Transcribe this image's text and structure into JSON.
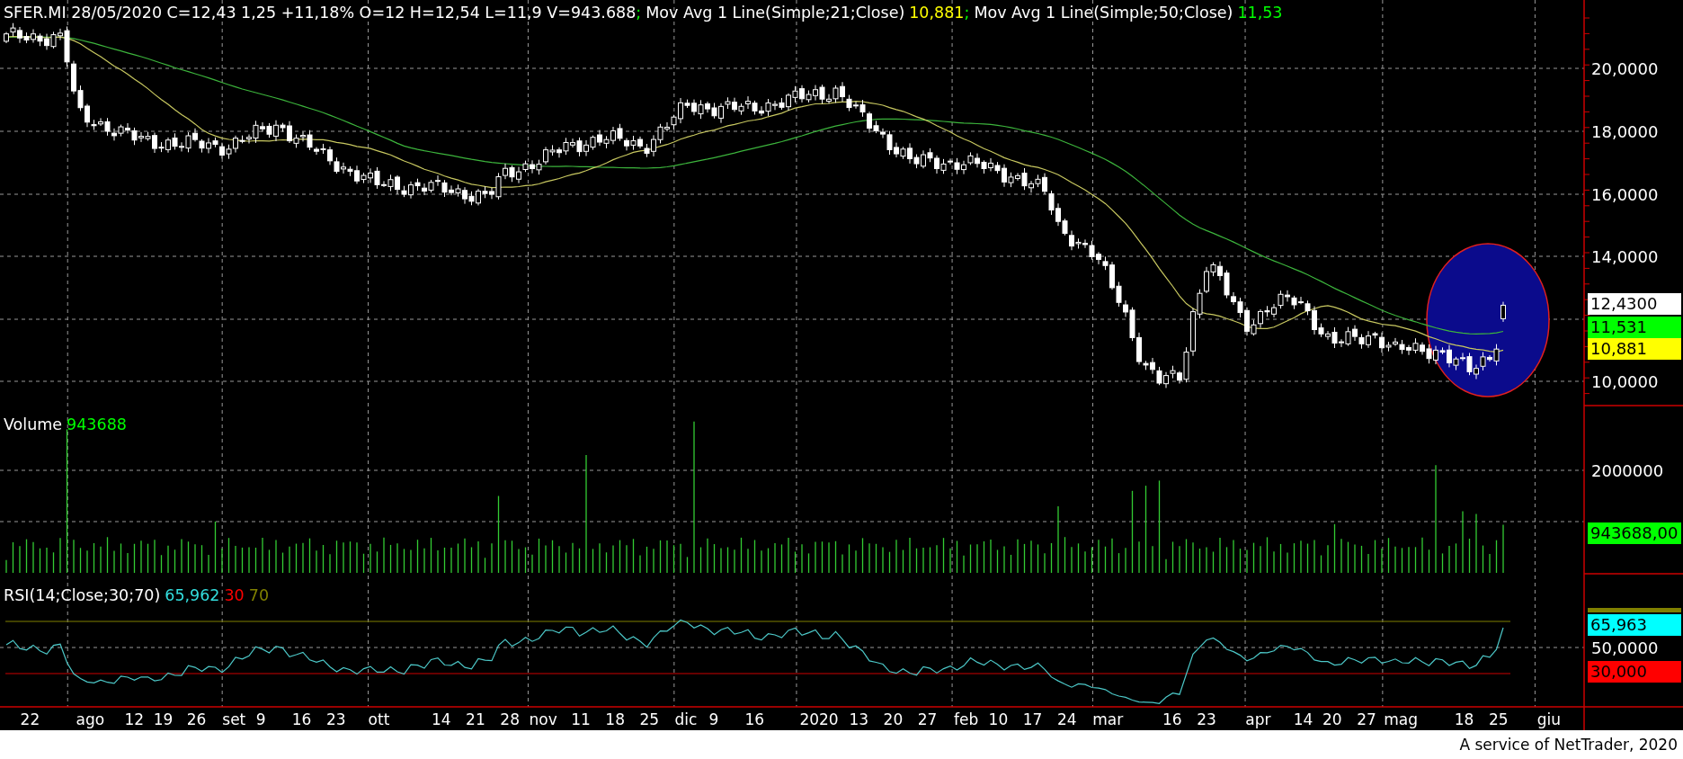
{
  "header": {
    "segments": [
      {
        "text": "SFER.MI 28/05/2020 C=12,43 1,25 +11,18% O=12 H=12,54 L=11,9 V=943.688",
        "color": "#ffffff"
      },
      {
        "text": ";",
        "color": "#00ff00",
        "kind": "separator"
      },
      {
        "text": "Mov Avg 1 Line(Simple;21;Close)",
        "color": "#ffffff"
      },
      {
        "text": "10,881",
        "color": "#ffff00"
      },
      {
        "text": ";",
        "color": "#00ff00",
        "kind": "separator"
      },
      {
        "text": "Mov Avg 1 Line(Simple;50;Close)",
        "color": "#ffffff"
      },
      {
        "text": "11,53",
        "color": "#00ff00"
      }
    ]
  },
  "price_panel": {
    "yticks": [
      "20,0000",
      "18,0000",
      "16,0000",
      "14,0000",
      "10,0000"
    ],
    "badges": [
      {
        "text": "12,4300",
        "color": "#ffffff"
      },
      {
        "text": "11,531",
        "color": "#00ff00"
      },
      {
        "text": "10,881",
        "color": "#ffff00"
      }
    ]
  },
  "volume_panel": {
    "legend": [
      {
        "text": "Volume",
        "color": "#ffffff"
      },
      {
        "text": "943688",
        "color": "#00ff00"
      }
    ],
    "yticks": [
      "2000000"
    ],
    "badges": [
      {
        "text": "943688,00",
        "color": "#00ff00"
      }
    ]
  },
  "rsi_panel": {
    "legend": [
      {
        "text": "RSI(14;Close;30;70)",
        "color": "#ffffff"
      },
      {
        "text": "65,962",
        "color": "#33dddd"
      },
      {
        "text": "30",
        "color": "#ff0000"
      },
      {
        "text": "70",
        "color": "#808000"
      }
    ],
    "yticks": [
      "50,0000"
    ],
    "badges": [
      {
        "text": "65,963",
        "color": "#00ffff"
      },
      {
        "text": "30,000",
        "color": "#ff0000"
      }
    ]
  },
  "x_axis": {
    "labels": [
      "22",
      "ago",
      "12",
      "19",
      "26",
      "set",
      "9",
      "16",
      "23",
      "ott",
      "14",
      "21",
      "28",
      "nov",
      "11",
      "18",
      "25",
      "dic",
      "9",
      "16",
      "2020",
      "13",
      "20",
      "27",
      "feb",
      "10",
      "17",
      "24",
      "mar",
      "16",
      "23",
      "apr",
      "14",
      "20",
      "27",
      "mag",
      "18",
      "25",
      "giu"
    ]
  },
  "footer": "A service of NetTrader, 2020"
}
